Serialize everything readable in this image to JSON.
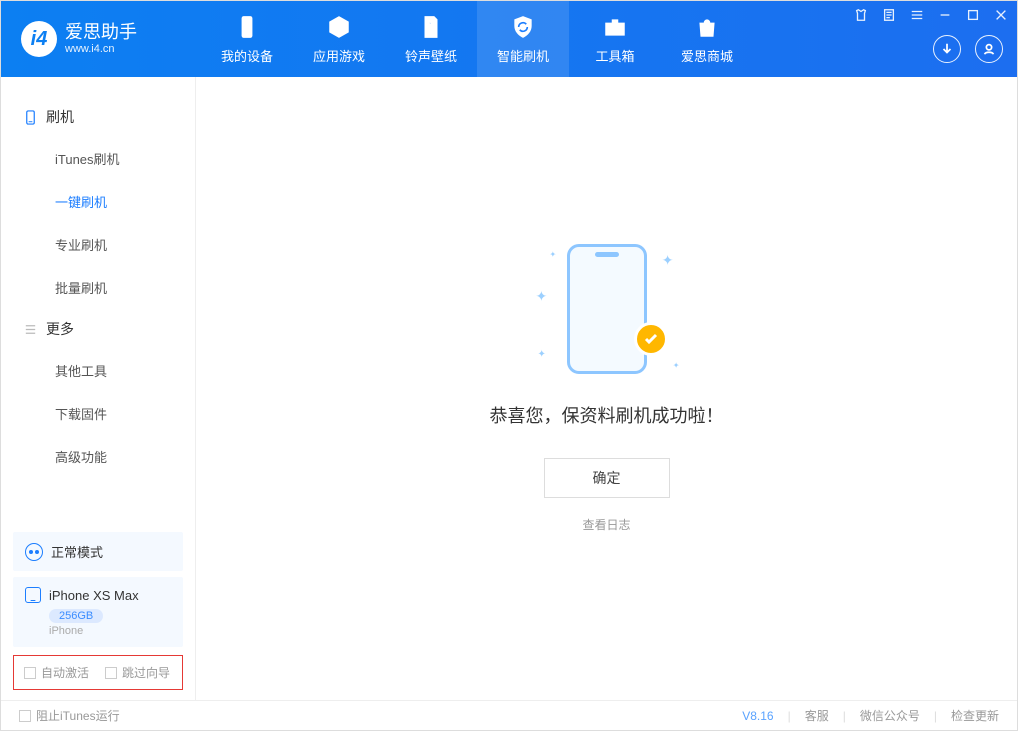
{
  "app": {
    "name": "爱思助手",
    "url": "www.i4.cn"
  },
  "nav": {
    "tabs": [
      {
        "label": "我的设备"
      },
      {
        "label": "应用游戏"
      },
      {
        "label": "铃声壁纸"
      },
      {
        "label": "智能刷机"
      },
      {
        "label": "工具箱"
      },
      {
        "label": "爱思商城"
      }
    ]
  },
  "sidebar": {
    "section1_title": "刷机",
    "section1_items": [
      {
        "label": "iTunes刷机"
      },
      {
        "label": "一键刷机"
      },
      {
        "label": "专业刷机"
      },
      {
        "label": "批量刷机"
      }
    ],
    "section2_title": "更多",
    "section2_items": [
      {
        "label": "其他工具"
      },
      {
        "label": "下载固件"
      },
      {
        "label": "高级功能"
      }
    ],
    "status_label": "正常模式",
    "device": {
      "name": "iPhone XS Max",
      "storage": "256GB",
      "type": "iPhone"
    },
    "opts": {
      "auto_activate": "自动激活",
      "skip_guide": "跳过向导"
    }
  },
  "main": {
    "success_msg": "恭喜您，保资料刷机成功啦！",
    "ok_btn": "确定",
    "view_log": "查看日志"
  },
  "footer": {
    "block_itunes": "阻止iTunes运行",
    "version": "V8.16",
    "support": "客服",
    "wechat": "微信公众号",
    "check_update": "检查更新"
  }
}
